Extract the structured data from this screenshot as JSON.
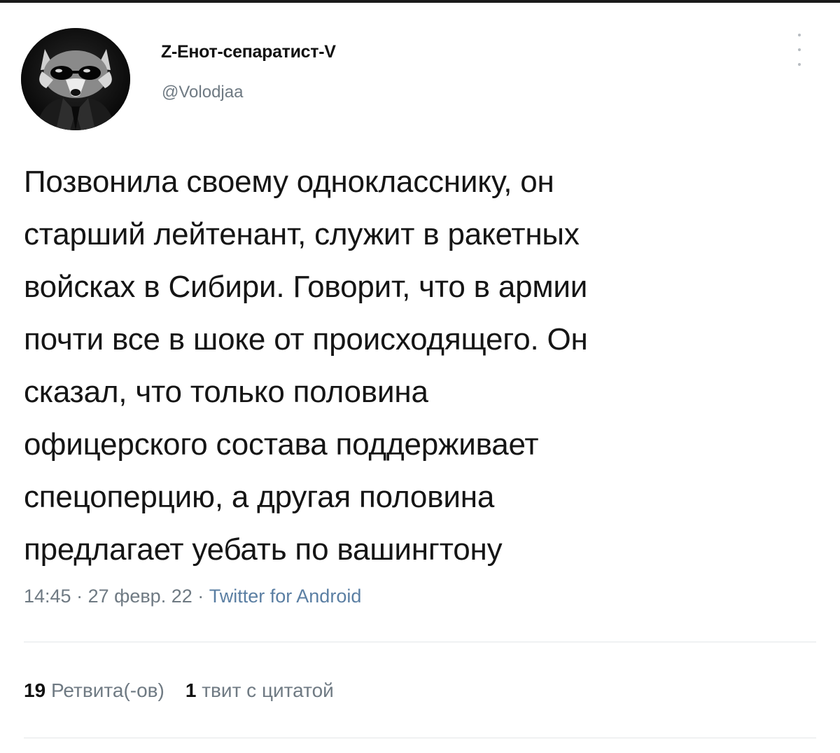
{
  "profile": {
    "display_name": "Z-Енот-сепаратист-V",
    "handle": "@Volodjaa"
  },
  "tweet": {
    "text": "Позвонила своему однокласснику, он\nстарший лейтенант, служит в ракетных\nвойсках в Сибири. Говорит, что в армии\nпочти все в шоке от происходящего. Он\nсказал, что только половина\nофицерского состава поддерживает\nспецоперцию, а другая половина\nпредлагает уебать по вашингтону",
    "time": "14:45",
    "date": "27 февр. 22",
    "separator": " · ",
    "source": "Twitter for Android"
  },
  "stats": {
    "retweets_count": "19",
    "retweets_label": "Ретвита(-ов)",
    "quotes_count": "1",
    "quotes_label": "твит с цитатой"
  },
  "icons": {
    "avatar": "raccoon-avatar-icon",
    "more": "more-vertical-icon"
  },
  "colors": {
    "text": "#151515",
    "secondary": "#6f7a83",
    "link": "#5b7fa3",
    "divider": "#e3e6e8"
  }
}
